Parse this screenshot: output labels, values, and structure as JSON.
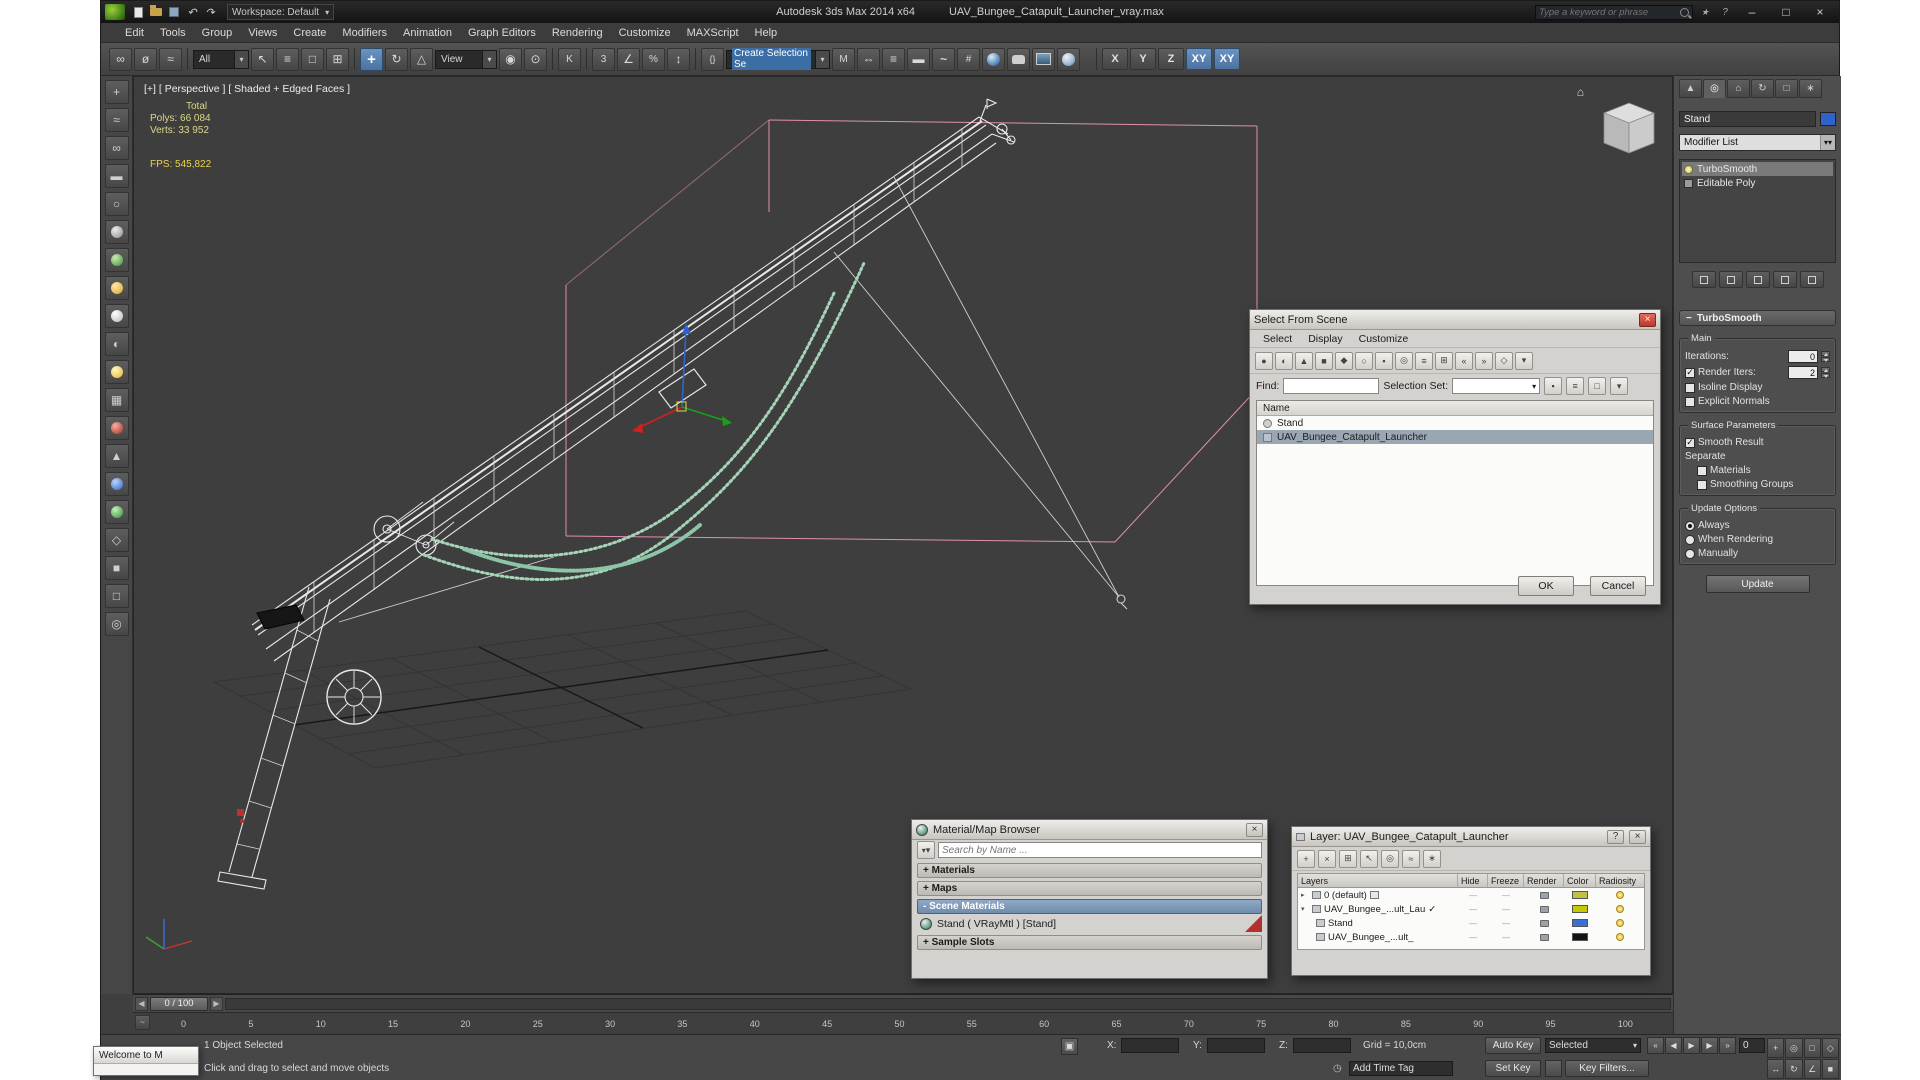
{
  "titlebar": {
    "workspace": "Workspace: Default",
    "app_title": "Autodesk 3ds Max  2014 x64",
    "file_title": "UAV_Bungee_Catapult_Launcher_vray.max",
    "search_placeholder": "Type a keyword or phrase",
    "minimize": "–",
    "maximize": "□",
    "close": "×"
  },
  "menus": [
    "Edit",
    "Tools",
    "Group",
    "Views",
    "Create",
    "Modifiers",
    "Animation",
    "Graph Editors",
    "Rendering",
    "Customize",
    "MAXScript",
    "Help"
  ],
  "toolbar": {
    "selection_filter": "All",
    "coord_system": "View",
    "named_selection": "Create Selection Se",
    "axis": [
      "X",
      "Y",
      "Z",
      "XY",
      "XY"
    ]
  },
  "viewport": {
    "label": "[+] [ Perspective ] [ Shaded + Edged Faces ]",
    "stats": {
      "total": "Total",
      "polys_label": "Polys:",
      "polys_value": "66 084",
      "verts_label": "Verts:",
      "verts_value": "33 952",
      "fps_label": "FPS:",
      "fps_value": "545,822"
    }
  },
  "select_dialog": {
    "title": "Select From Scene",
    "menus": [
      "Select",
      "Display",
      "Customize"
    ],
    "find_label": "Find:",
    "selection_set_label": "Selection Set:",
    "name_header": "Name",
    "rows": [
      {
        "label": "Stand"
      },
      {
        "label": "UAV_Bungee_Catapult_Launcher"
      }
    ],
    "ok": "OK",
    "cancel": "Cancel",
    "close": "×"
  },
  "material_browser": {
    "title": "Material/Map Browser",
    "close": "×",
    "search_placeholder": "Search by Name ...",
    "sections": [
      {
        "label": "+ Materials"
      },
      {
        "label": "+ Maps"
      },
      {
        "label": "- Scene Materials"
      },
      {
        "label": "+ Sample Slots"
      }
    ],
    "scene_material": "Stand  ( VRayMtl )  [Stand]"
  },
  "layer_dialog": {
    "title": "Layer: UAV_Bungee_Catapult_Launcher",
    "help": "?",
    "close": "×",
    "columns": [
      "Layers",
      "Hide",
      "Freeze",
      "Render",
      "Color",
      "Radiosity"
    ],
    "rows": [
      {
        "label": "0 (default)",
        "color": "#c0c048"
      },
      {
        "label": "UAV_Bungee_...ult_Lau",
        "check": "✓",
        "color": "#c8c800"
      },
      {
        "label": "Stand",
        "color": "#3a6fd8"
      },
      {
        "label": "UAV_Bungee_...ult_",
        "color": "#141414"
      }
    ]
  },
  "command_panel": {
    "object_name": "Stand",
    "object_color": "#2e63c9",
    "modifier_list": "Modifier List",
    "stack": [
      {
        "label": "TurboSmooth"
      },
      {
        "label": "Editable Poly"
      }
    ],
    "rollout": "TurboSmooth",
    "main_group": "Main",
    "iterations_label": "Iterations:",
    "iterations_value": "0",
    "render_iters_label": "Render Iters:",
    "render_iters_value": "2",
    "isoline": "Isoline Display",
    "explicit_normals": "Explicit Normals",
    "surface_group": "Surface Parameters",
    "smooth_result": "Smooth Result",
    "separate": "Separate",
    "materials": "Materials",
    "smoothing_groups": "Smoothing Groups",
    "update_group": "Update Options",
    "always": "Always",
    "when_rendering": "When Rendering",
    "manually": "Manually",
    "update_button": "Update"
  },
  "timeline": {
    "slider": "0 / 100",
    "ticks": [
      "0",
      "5",
      "10",
      "15",
      "20",
      "25",
      "30",
      "35",
      "40",
      "45",
      "50",
      "55",
      "60",
      "65",
      "70",
      "75",
      "80",
      "85",
      "90",
      "95",
      "100"
    ]
  },
  "status": {
    "object_selected": "1 Object Selected",
    "prompt": "Click and drag to select and move objects",
    "welcome": "Welcome to M",
    "x_label": "X:",
    "y_label": "Y:",
    "z_label": "Z:",
    "grid": "Grid = 10,0cm",
    "add_time_tag": "Add Time Tag",
    "auto_key": "Auto Key",
    "selected_combo": "Selected",
    "set_key": "Set Key",
    "key_filters": "Key Filters...",
    "frame": "0"
  }
}
